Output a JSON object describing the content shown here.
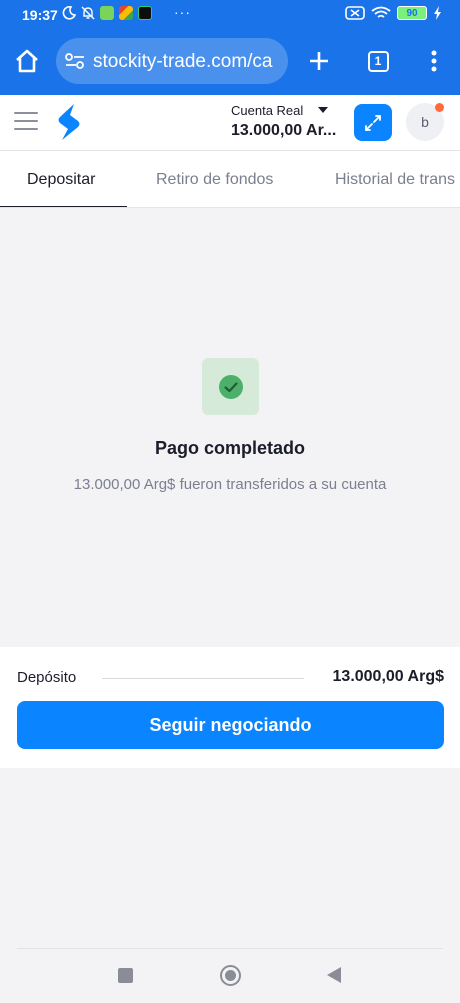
{
  "status_bar": {
    "time": "19:37",
    "overflow": "···",
    "battery": "90"
  },
  "browser": {
    "url": "stockity-trade.com/ca",
    "tab_count": "1"
  },
  "header": {
    "account_label": "Cuenta Real",
    "balance": "13.000,00 Ar...",
    "avatar_letter": "b"
  },
  "tabs": [
    {
      "label": "Depositar",
      "active": true
    },
    {
      "label": "Retiro de fondos",
      "active": false
    },
    {
      "label": "Historial de trans",
      "active": false
    }
  ],
  "success": {
    "title": "Pago completado",
    "subtitle": "13.000,00 Arg$ fueron transferidos a su cuenta"
  },
  "deposit": {
    "label": "Depósito",
    "value": "13.000,00 Arg$",
    "cta": "Seguir negociando"
  },
  "colors": {
    "browser_blue": "#1a73e8",
    "accent": "#0a84ff",
    "success_bg": "#d6ead9",
    "success_icon": "#4caf6a",
    "notification": "#ff6a3d"
  }
}
